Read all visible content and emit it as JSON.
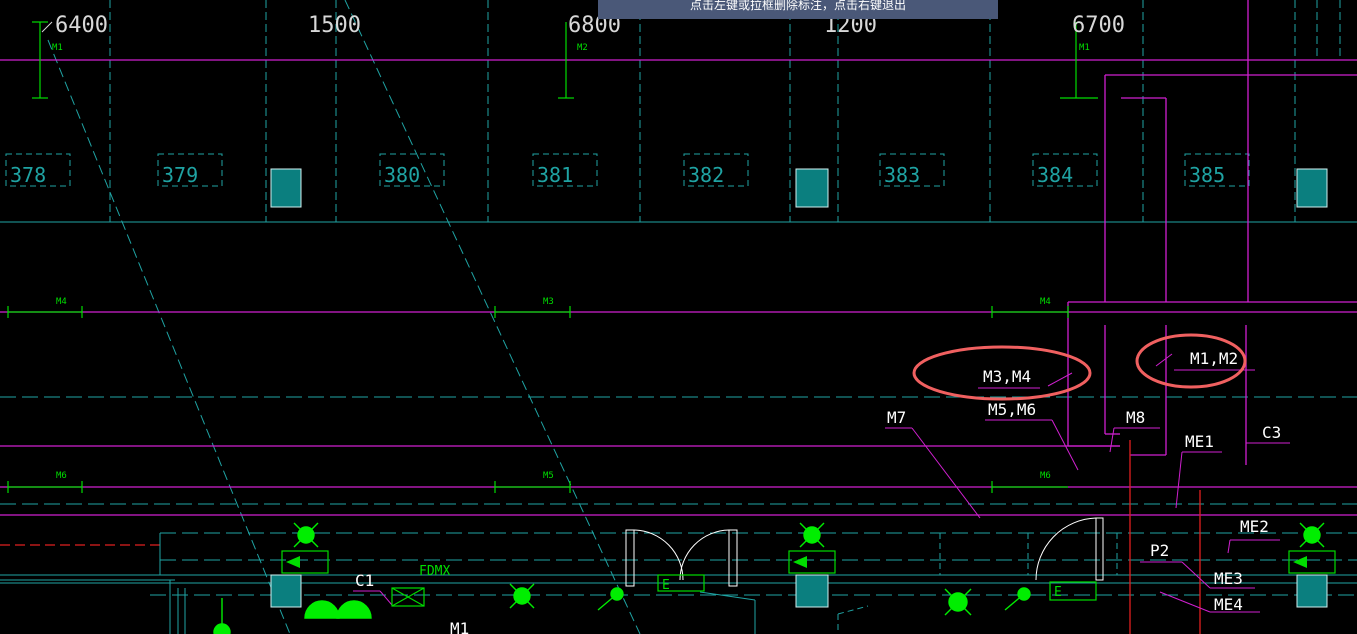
{
  "status_tip": "点击左键或拉框删除标注，点击右键退出",
  "dimensions": [
    "6400",
    "1500",
    "6800",
    "1200",
    "6700"
  ],
  "rooms": [
    "378",
    "379",
    "380",
    "381",
    "382",
    "383",
    "384",
    "385"
  ],
  "small_marks": {
    "top_m1_left": "M1",
    "top_m2": "M2",
    "top_m1_right": "M1",
    "row1_m4_left": "M4",
    "row1_m3": "M3",
    "row1_m4_right": "M4",
    "row2_m6_left": "M6",
    "row2_m5": "M5",
    "row2_m6_right": "M6"
  },
  "annotations": {
    "m3m4": "M3,M4",
    "m1m2": "M1,M2",
    "m5m6": "M5,M6",
    "m7": "M7",
    "m8": "M8",
    "me1": "ME1",
    "c3": "C3",
    "me2": "ME2",
    "p2": "P2",
    "me3": "ME3",
    "me4": "ME4",
    "c1": "C1",
    "fdmx": "FDMX",
    "m1_bottom": "M1",
    "e_left": "E",
    "e_right": "E"
  },
  "colors": {
    "background": "#000000",
    "magenta": "#d020d0",
    "cyan": "#1fa3a3",
    "green": "#00dd00",
    "red": "#e02020",
    "highlight_circle": "#f06060",
    "teal_block": "#0b7f7f"
  }
}
